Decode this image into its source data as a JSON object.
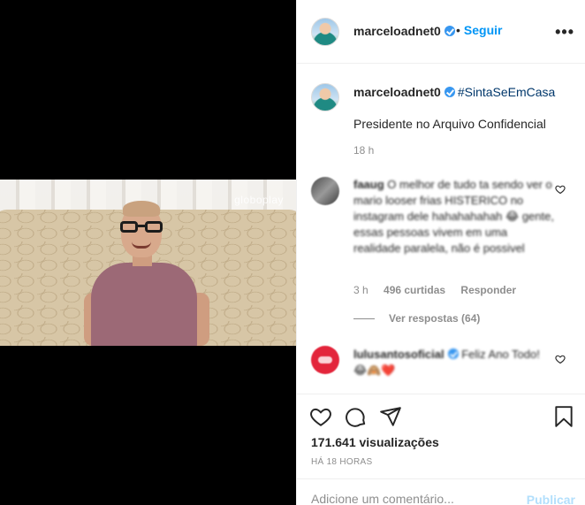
{
  "video": {
    "watermark": "globoplay"
  },
  "header": {
    "username": "marceloadnet0",
    "separator": "•",
    "follow_label": "Seguir",
    "more_label": "•••"
  },
  "caption": {
    "username": "marceloadnet0",
    "hashtag": "#SintaSeEmCasa",
    "text": "Presidente no Arquivo Confidencial",
    "time": "18 h"
  },
  "comments": [
    {
      "username": "faaug",
      "text": "O melhor de tudo ta sendo ver o mario looser frias HISTERICO no instagram dele hahahahahah 😂 gente, essas pessoas vivem em uma realidade paralela, não é possivel",
      "time": "3 h",
      "likes": "496 curtidas",
      "reply_label": "Responder",
      "view_replies": "Ver respostas (64)"
    },
    {
      "username": "lulusantosoficial",
      "text": "Feliz Ano Todo! 😂🙈❤️"
    }
  ],
  "actions": {
    "views": "171.641 visualizações",
    "time_ago": "HÁ 18 HORAS"
  },
  "comment_box": {
    "placeholder": "Adicione um comentário...",
    "publish_label": "Publicar"
  },
  "colors": {
    "accent": "#0095f6",
    "verified": "#3897f0",
    "muted": "#8e8e8e",
    "publish_disabled": "#b2dffc"
  }
}
